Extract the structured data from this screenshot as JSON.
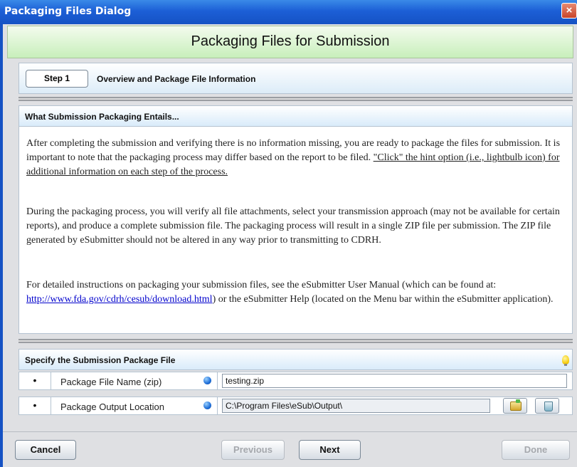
{
  "window": {
    "title": "Packaging Files Dialog",
    "close_label": "×"
  },
  "header": {
    "title": "Packaging Files for Submission"
  },
  "step": {
    "label": "Step 1",
    "description": "Overview and Package File Information"
  },
  "overview": {
    "header": "What Submission Packaging Entails...",
    "p1_text": "After completing the submission and verifying there is no information missing, you are ready to package the files for submission. It is important to note that the packaging process may differ based on the report to be filed. ",
    "p1_underlined": "\"Click\" the hint option (i.e., lightbulb icon) for additional information on each step of the process.",
    "p2": "During the packaging process, you will verify all file attachments, select your transmission approach (may not be available for certain reports), and produce a complete submission file. The packaging process will result in a single ZIP file per submission. The ZIP file generated by eSubmitter should not be altered in any way prior to transmitting to CDRH.",
    "p3_before": "For detailed instructions on packaging your submission files, see the eSubmitter User Manual (which can be found at: ",
    "p3_link": "http://www.fda.gov/cdrh/cesub/download.html",
    "p3_after": ") or the eSubmitter Help (located on the Menu bar within the eSubmitter application)."
  },
  "package": {
    "header": "Specify the Submission Package File",
    "hint_icon": "lightbulb-icon",
    "rows": [
      {
        "bullet": "•",
        "label": "Package File Name (zip)",
        "value": "testing.zip"
      },
      {
        "bullet": "•",
        "label": "Package Output Location",
        "value": "C:\\Program Files\\eSub\\Output\\"
      }
    ],
    "required_indicator_color": "#1f6fd8"
  },
  "footer": {
    "cancel": "Cancel",
    "previous": "Previous",
    "next": "Next",
    "done": "Done"
  },
  "colors": {
    "titlebar": "#1c5fd6",
    "header_band": "#c8efbb",
    "section_header": "#d9ebfa",
    "link": "#0000cc"
  }
}
